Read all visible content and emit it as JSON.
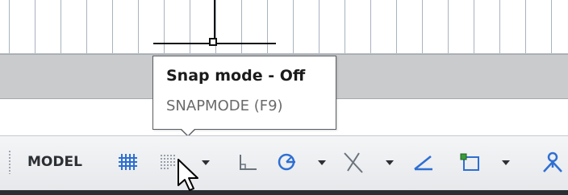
{
  "tooltip": {
    "title": "Snap mode - Off",
    "command": "SNAPMODE (F9)"
  },
  "statusbar": {
    "model_label": "MODEL",
    "icons": [
      "grid-icon",
      "snap-mode-icon",
      "dropdown-arrow-icon",
      "ortho-icon",
      "polar-tracking-icon",
      "isodraft-icon",
      "object-snap-tracking-icon",
      "object-snap-icon",
      "annotation-scale-icon"
    ]
  },
  "colors": {
    "accent_blue": "#2e6fd3",
    "green": "#3a9b3a",
    "grid_line": "#a9b2bf"
  }
}
